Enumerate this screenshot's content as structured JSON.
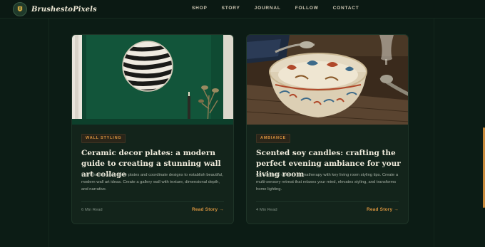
{
  "brand": {
    "name": "BrushestoPixels",
    "logo_icon": "brush-crest-icon"
  },
  "nav": [
    {
      "label": "SHOP"
    },
    {
      "label": "STORY"
    },
    {
      "label": "JOURNAL"
    },
    {
      "label": "FOLLOW"
    },
    {
      "label": "CONTACT"
    }
  ],
  "colors": {
    "background": "#0c1c15",
    "card": "#13241b",
    "accent": "#d8933e",
    "scroll_thumb": "#c98a3a"
  },
  "cards": [
    {
      "image": "zebra-plate-on-green-wall",
      "tag": "WALL STYLING",
      "title": "Ceramic decor plates: a modern guide to creating a stunning wall art collage",
      "excerpt": "Learn how to hang decor plates and coordinate designs to establish beautiful, modern wall art ideas. Create a gallery wall with texture, dimensional depth, and narrative.",
      "read_time": "6 Min Read",
      "link": "Read Story →"
    },
    {
      "image": "painted-ceramic-bowl-on-table",
      "tag": "AMBIANCE",
      "title": "Scented soy candles: crafting the perfect evening ambiance for your living room",
      "excerpt": "Combine soy candles aromatherapy with key living room styling tips. Create a multi-sensory retreat that relaxes your mind, elevates styling, and transforms home lighting.",
      "read_time": "4 Min Read",
      "link": "Read Story →"
    }
  ]
}
